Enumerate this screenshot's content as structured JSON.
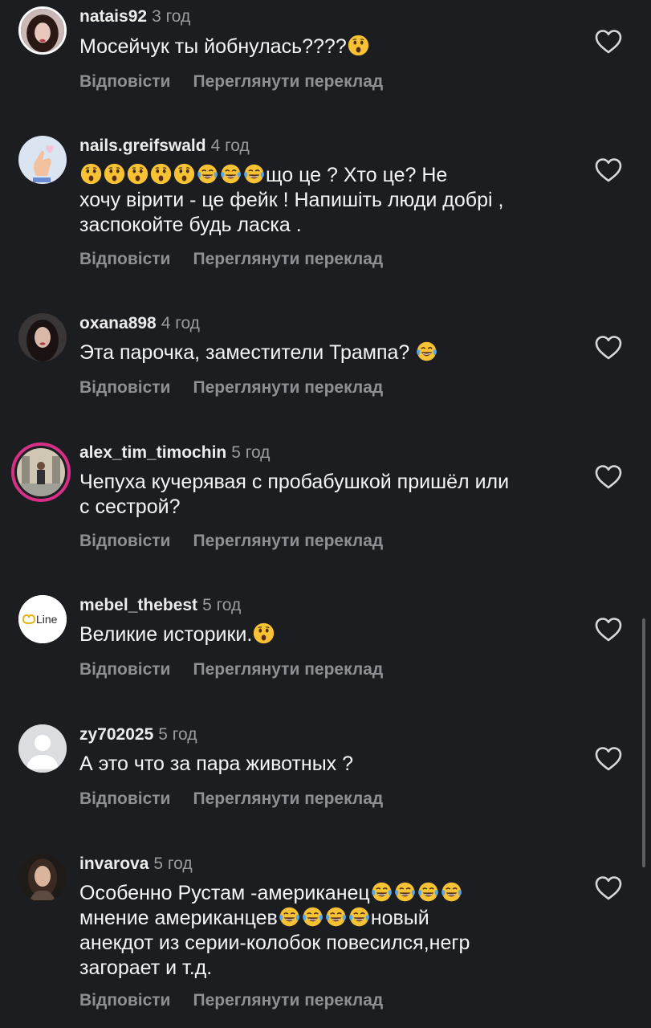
{
  "comments": [
    {
      "user": "natais92",
      "time": "3 год",
      "text_parts": [
        "Мосейчук ты йобнулась????"
      ],
      "text_suffix_emojis": [
        "astonished"
      ],
      "reply": "Відповісти",
      "translate": "Переглянути переклад"
    },
    {
      "user": "nails.greifswald",
      "time": "4 год",
      "lead_emojis": [
        "astonished",
        "astonished",
        "astonished",
        "astonished",
        "astonished",
        "joy",
        "joy",
        "joy"
      ],
      "text_line1": "що це ? Хто це? Не",
      "text_line2": "хочу вірити - це фейк ! Напишіть люди добрі ,",
      "text_line3": "заспокойте будь ласка .",
      "reply": "Відповісти",
      "translate": "Переглянути переклад"
    },
    {
      "user": "oxana898",
      "time": "4 год",
      "text": "Эта парочка, заместители Трампа? ",
      "text_suffix_emojis": [
        "joy"
      ],
      "reply": "Відповісти",
      "translate": "Переглянути переклад"
    },
    {
      "user": "alex_tim_timochin",
      "time": "5 год",
      "text_line1": "Чепуха кучерявая с пробабушкой пришёл или",
      "text_line2": "с сестрой?",
      "reply": "Відповісти",
      "translate": "Переглянути переклад"
    },
    {
      "user": "mebel_thebest",
      "time": "5 год",
      "avatar_text": "Line",
      "text": "Великие историки.",
      "text_suffix_emojis": [
        "astonished"
      ],
      "reply": "Відповісти",
      "translate": "Переглянути переклад"
    },
    {
      "user": "zy702025",
      "time": "5 год",
      "text": "А это что за пара животных ?",
      "reply": "Відповісти",
      "translate": "Переглянути переклад"
    },
    {
      "user": "invarova",
      "time": "5 год",
      "text_line1": "Особенно Рустам -американец",
      "line1_emojis": [
        "joy",
        "joy",
        "joy",
        "joy"
      ],
      "text_line2": "мнение американцев",
      "line2_emojis": [
        "joy",
        "joy",
        "joy",
        "joy"
      ],
      "text_line2_after": "новый",
      "text_line3": "анекдот из серии-колобок повесился,негр",
      "text_line4": "загорает и т.д.",
      "reply": "Відповісти",
      "translate": "Переглянути переклад"
    }
  ],
  "icons": {
    "like": "heart-outline-icon",
    "astonished": "astonished-face-emoji",
    "joy": "tears-of-joy-emoji"
  },
  "colors": {
    "background": "#1c1d21",
    "username": "#ececec",
    "muted": "#9a9ba0",
    "story_ring": "#d62f86"
  }
}
